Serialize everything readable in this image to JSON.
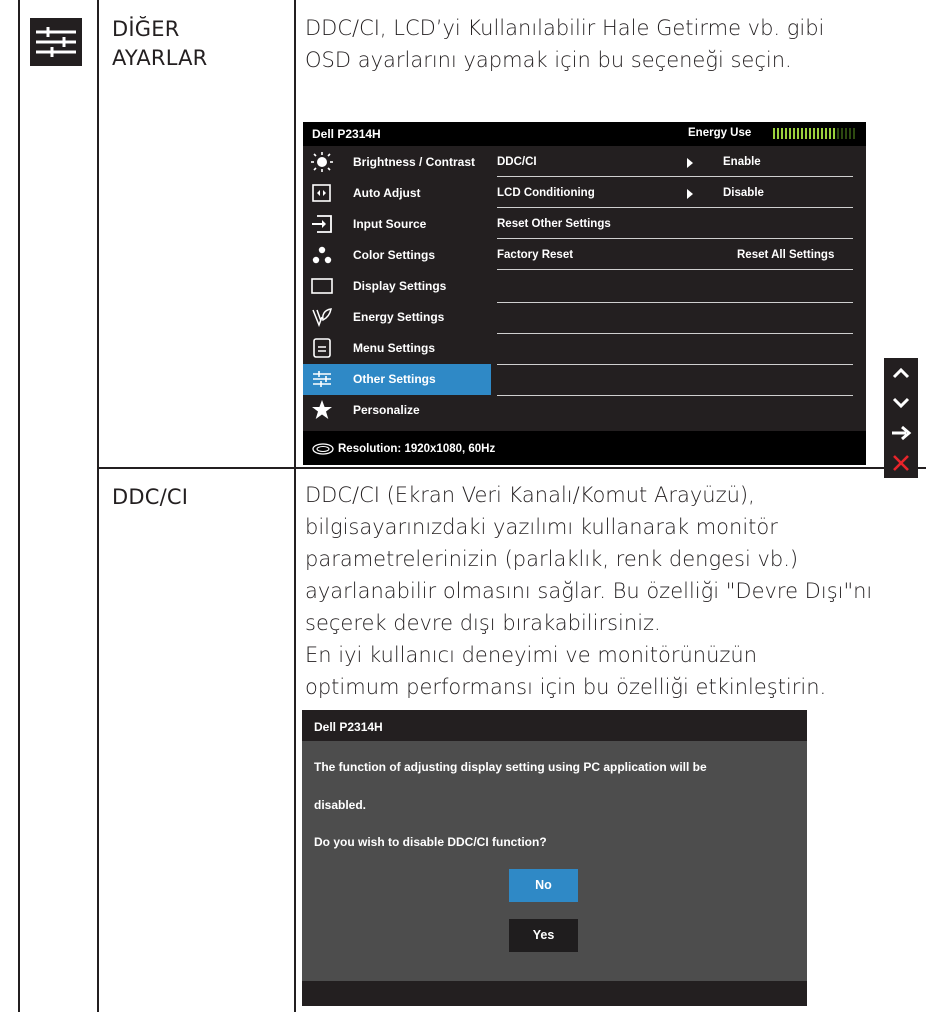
{
  "row1": {
    "icon": "other-settings-icon",
    "label_line1": "DİĞER",
    "label_line2": "AYARLAR",
    "description": [
      "DDC/CI, LCD’yi Kullanılabilir Hale Getirme vb. gibi",
      "OSD ayarlarını yapmak için bu seçeneği seçin."
    ]
  },
  "osd": {
    "title": "Dell P2314H",
    "energy_label": "Energy Use",
    "menu": [
      {
        "label": "Brightness / Contrast",
        "icon": "brightness-icon"
      },
      {
        "label": "Auto Adjust",
        "icon": "auto-adjust-icon"
      },
      {
        "label": "Input Source",
        "icon": "input-source-icon"
      },
      {
        "label": "Color Settings",
        "icon": "color-settings-icon"
      },
      {
        "label": "Display Settings",
        "icon": "display-settings-icon"
      },
      {
        "label": "Energy Settings",
        "icon": "energy-settings-icon"
      },
      {
        "label": "Menu Settings",
        "icon": "menu-settings-icon"
      },
      {
        "label": "Other Settings",
        "icon": "other-settings-icon",
        "active": true
      },
      {
        "label": "Personalize",
        "icon": "star-icon"
      }
    ],
    "rows": [
      {
        "key": "DDC/CI",
        "value": "Enable",
        "has_arrow": true
      },
      {
        "key": "LCD Conditioning",
        "value": "Disable",
        "has_arrow": true
      },
      {
        "key": "Reset Other Settings",
        "value": "",
        "has_arrow": false
      },
      {
        "key": "Factory Reset",
        "value": "Reset All Settings",
        "has_arrow": false
      }
    ],
    "footer": "Resolution: 1920x1080, 60Hz",
    "active_color": "#2f89c6",
    "energy_color": "#9ad13c"
  },
  "nav_buttons": [
    {
      "name": "up-icon",
      "color": "#ffffff"
    },
    {
      "name": "down-icon",
      "color": "#ffffff"
    },
    {
      "name": "right-arrow-icon",
      "color": "#ffffff"
    },
    {
      "name": "close-icon",
      "color": "#e8242a"
    }
  ],
  "row2": {
    "label": "DDC/CI",
    "description": [
      "DDC/CI (Ekran Veri Kanalı/Komut Arayüzü),",
      "bilgisayarınızdaki yazılımı kullanarak monitör",
      "parametrelerinizin (parlaklık, renk dengesi vb.)",
      "ayarlanabilir olmasını sağlar. Bu özelliği \"Devre Dışı\"nı",
      "seçerek devre dışı bırakabilirsiniz.",
      "En iyi kullanıcı deneyimi ve monitörünüzün",
      "optimum performansı için bu özelliği etkinleştirin."
    ]
  },
  "dialog": {
    "title": "Dell P2314H",
    "line1": "The function of adjusting display setting using PC application will be",
    "line2": "disabled.",
    "line3": "Do you wish to disable DDC/CI function?",
    "no_label": "No",
    "yes_label": "Yes"
  }
}
